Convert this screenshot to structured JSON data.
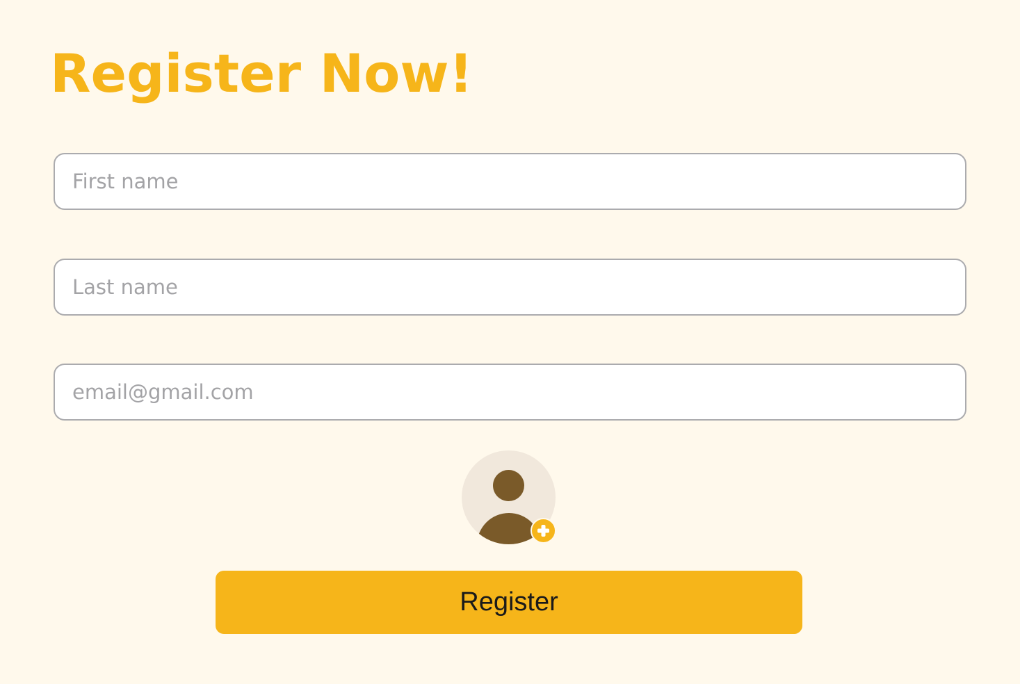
{
  "page": {
    "title": "Register Now!"
  },
  "form": {
    "first_name": {
      "placeholder": "First name",
      "value": ""
    },
    "last_name": {
      "placeholder": "Last name",
      "value": ""
    },
    "email": {
      "placeholder": "email@gmail.com",
      "value": ""
    },
    "avatar": {
      "icon": "user-avatar-icon",
      "add_icon": "plus-icon"
    },
    "submit_label": "Register"
  },
  "colors": {
    "background": "#FFF9EC",
    "accent": "#F6B51A",
    "avatar_figure": "#7A5A29",
    "avatar_bg": "#F1E8DC",
    "field_border": "#ABABAE",
    "placeholder": "#A3A3A6"
  }
}
